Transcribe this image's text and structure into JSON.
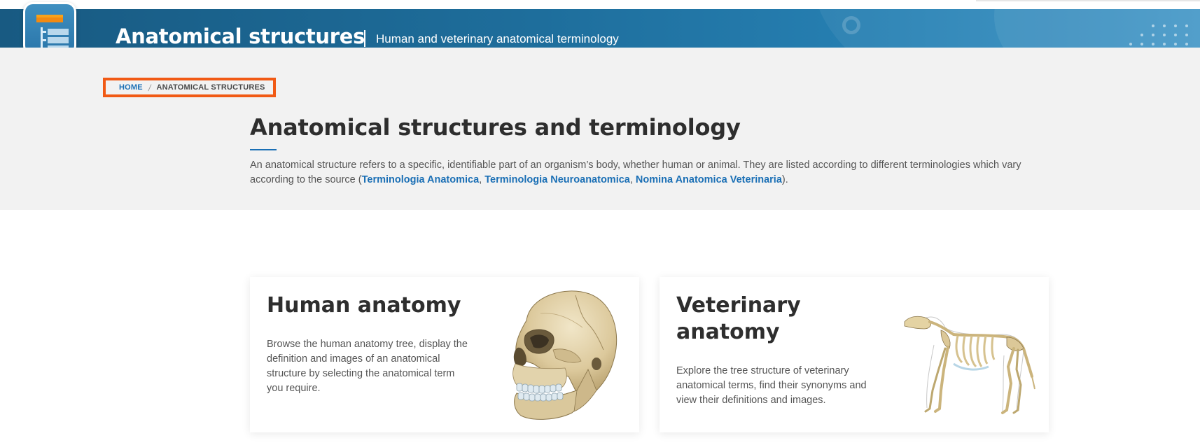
{
  "header": {
    "app_title": "Anatomical structures",
    "app_subtitle": "Human and veterinary anatomical terminology",
    "logo_icon": "tree-structure-icon"
  },
  "breadcrumb": {
    "items": [
      "HOME",
      "ANATOMICAL STRUCTURES"
    ]
  },
  "intro": {
    "title": "Anatomical structures and terminology",
    "text_before": "An anatomical structure refers to a specific, identifiable part of an organism’s body, whether human or animal. They are listed according to different terminologies which vary according to the source (",
    "links": [
      "Terminologia Anatomica",
      "Terminologia Neuroanatomica",
      "Nomina Anatomica Veterinaria"
    ],
    "separator": ", ",
    "text_after": ")."
  },
  "cards": [
    {
      "title": "Human anatomy",
      "description": "Browse the human anatomy tree, display the definition and images of an anatomical structure by selecting the anatomical term you require.",
      "image": "human-skull-illustration"
    },
    {
      "title": "Veterinary anatomy",
      "description": "Explore the tree structure of veterinary anatomical terms, find their synonyms and view their definitions and images.",
      "image": "dog-skeleton-illustration"
    }
  ],
  "colors": {
    "banner": "#1e6e9c",
    "link": "#1a6fb5",
    "highlight_border": "#f15a15",
    "hero_bg": "#f2f2f2",
    "logo_bar": "#f7a21b"
  }
}
